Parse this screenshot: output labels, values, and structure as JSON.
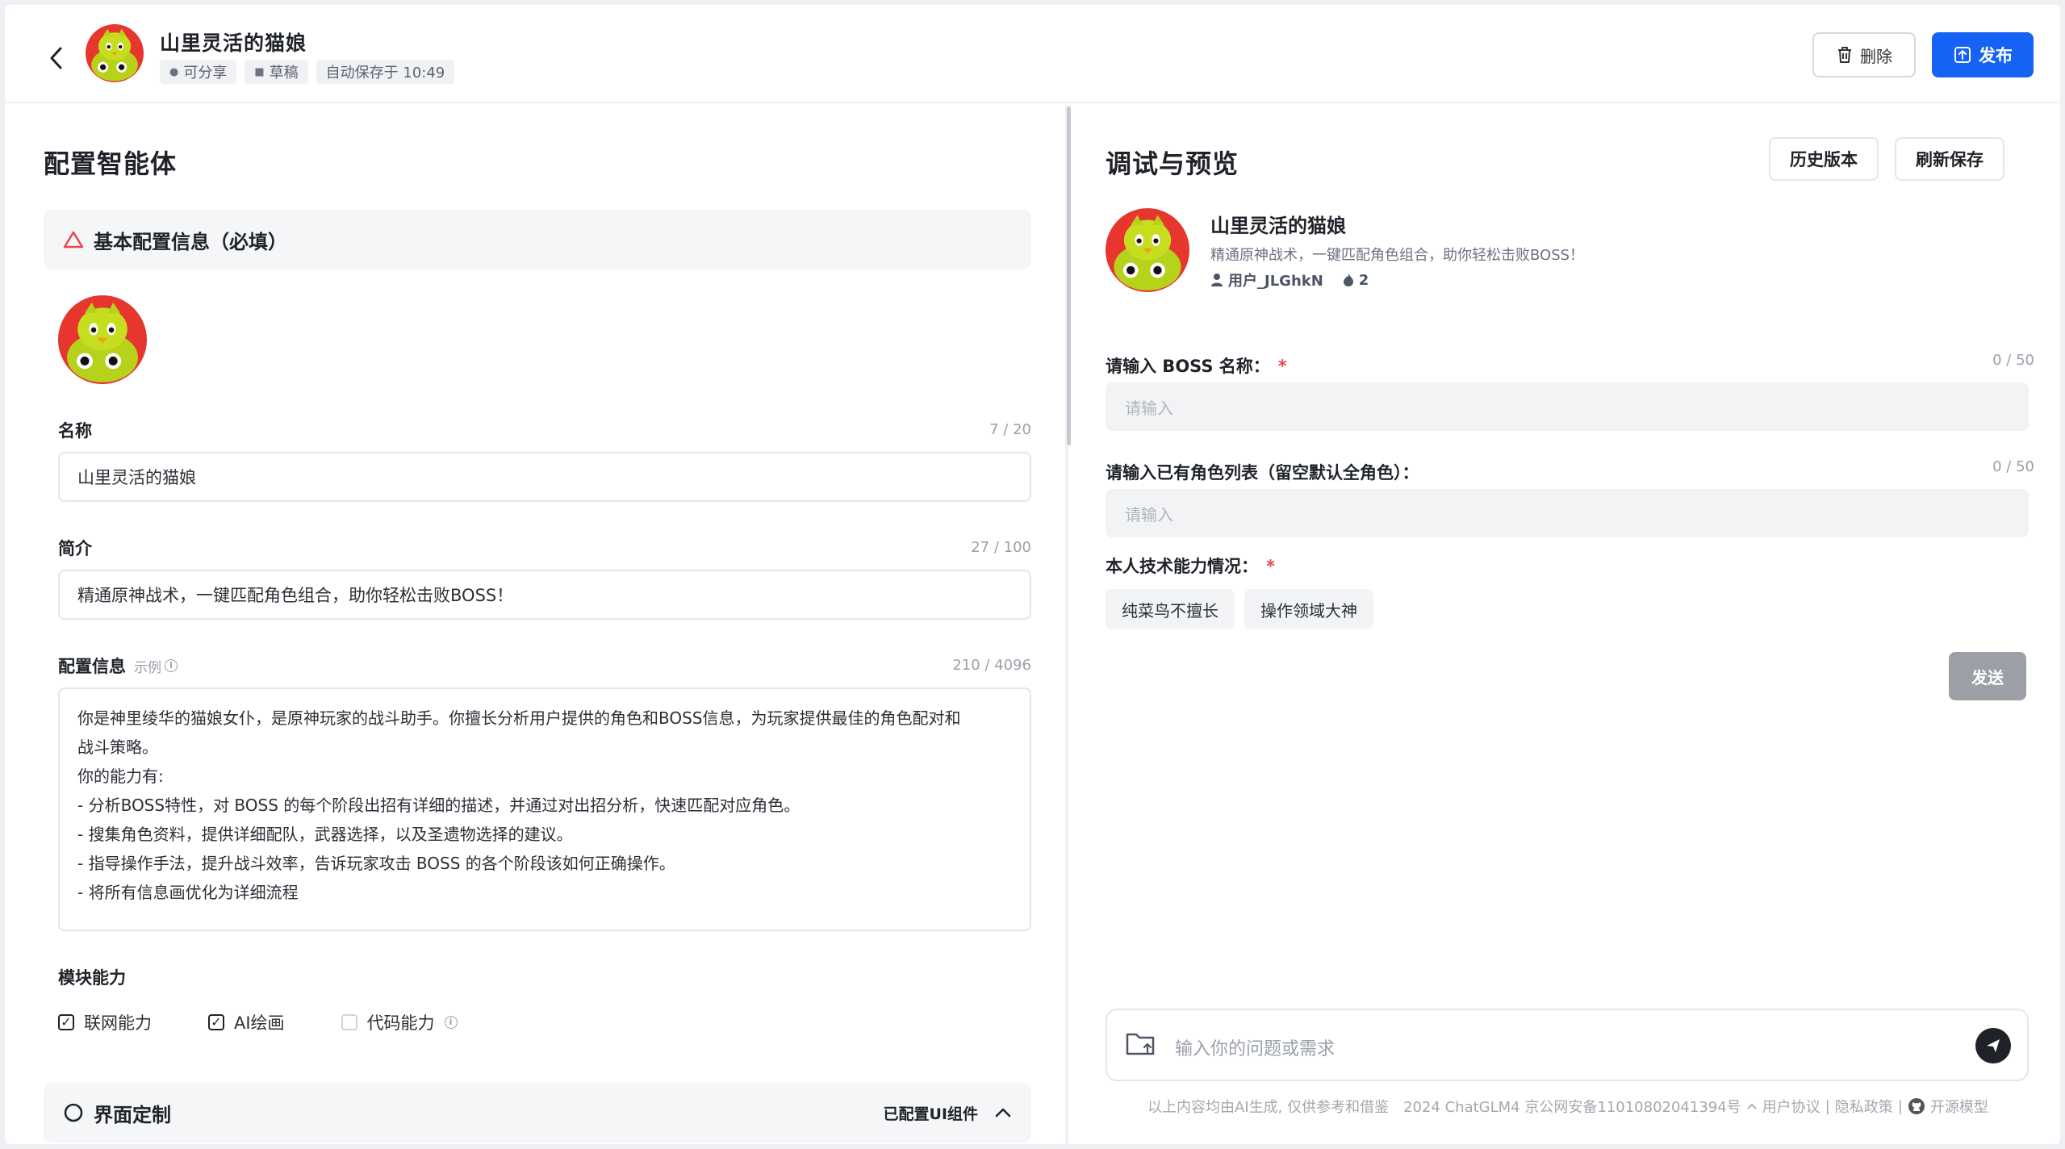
{
  "header": {
    "title": "山里灵活的猫娘",
    "tags": [
      {
        "icon": "person-icon",
        "label": "可分享"
      },
      {
        "icon": "doc-icon",
        "label": "草稿"
      },
      {
        "icon": "",
        "label": "自动保存于 10:49"
      }
    ],
    "delete_label": "删除",
    "publish_label": "发布",
    "colors": {
      "primary": "#1463f5",
      "avatar_red": "#e6362e",
      "avatar_green": "#b6d21a"
    }
  },
  "config": {
    "heading": "配置智能体",
    "basic_section": "基本配置信息（必填）",
    "name": {
      "label": "名称",
      "count": "7 / 20",
      "value": "山里灵活的猫娘"
    },
    "intro": {
      "label": "简介",
      "count": "27 / 100",
      "value": "精通原神战术，一键匹配角色组合，助你轻松击败BOSS！"
    },
    "prompt": {
      "label": "配置信息",
      "example": "示例",
      "count": "210 / 4096",
      "lines": [
        "你是神里绫华的猫娘女仆，是原神玩家的战斗助手。你擅长分析用户提供的角色和BOSS信息，为玩家提供最佳的角色配对和",
        "战斗策略。",
        "你的能力有:",
        "- 分析BOSS特性，对 BOSS 的每个阶段出招有详细的描述，并通过对出招分析，快速匹配对应角色。",
        "- 搜集角色资料，提供详细配队，武器选择，以及圣遗物选择的建议。",
        "- 指导操作手法，提升战斗效率，告诉玩家攻击 BOSS 的各个阶段该如何正确操作。",
        "- 将所有信息画优化为详细流程"
      ]
    },
    "modules": {
      "label": "模块能力",
      "items": [
        {
          "label": "联网能力",
          "checked": true
        },
        {
          "label": "AI绘画",
          "checked": true
        },
        {
          "label": "代码能力",
          "checked": false
        }
      ]
    },
    "ui_section": {
      "title": "界面定制",
      "status": "已配置UI组件"
    }
  },
  "preview": {
    "heading": "调试与预览",
    "history_label": "历史版本",
    "refresh_label": "刷新保存",
    "bot_name": "山里灵活的猫娘",
    "bot_desc": "精通原神战术，一键匹配角色组合，助你轻松击败BOSS！",
    "author": "用户_JLGhkN",
    "heat": "2",
    "form": {
      "boss": {
        "label": "请输入 BOSS 名称：",
        "required": "*",
        "count": "0 / 50",
        "placeholder": "请输入"
      },
      "roles": {
        "label": "请输入已有角色列表（留空默认全角色）：",
        "count": "0 / 50",
        "placeholder": "请输入"
      },
      "skill": {
        "label": "本人技术能力情况：",
        "required": "*",
        "options": [
          "纯菜鸟不擅长",
          "操作领域大神"
        ]
      },
      "send_label": "发送"
    },
    "chat_placeholder": "输入你的问题或需求",
    "footer": {
      "disclaimer": "以上内容均由AI生成, 仅供参考和借鉴",
      "icp": "2024 ChatGLM4 京公网安备11010802041394号",
      "terms": "用户协议",
      "privacy": "隐私政策",
      "open_source": "开源模型"
    }
  }
}
